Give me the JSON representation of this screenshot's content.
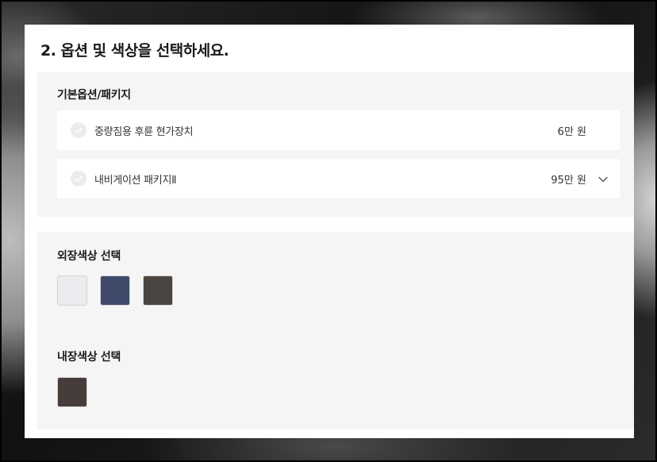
{
  "title": "2. 옵션 및 색상을 선택하세요.",
  "options_section": {
    "title": "기본옵션/패키지",
    "items": [
      {
        "label": "중량짐용 후륜 현가장치",
        "price": "6만 원",
        "expandable": false,
        "checked": false
      },
      {
        "label": "내비게이션 패키지Ⅱ",
        "price": "95만 원",
        "expandable": true,
        "checked": false
      }
    ]
  },
  "exterior_section": {
    "title": "외장색상 선택",
    "swatches": [
      {
        "color": "#ecebf0"
      },
      {
        "color": "#3f4a6b"
      },
      {
        "color": "#4b4542"
      }
    ]
  },
  "interior_section": {
    "title": "내장색상 선택",
    "swatches": [
      {
        "color": "#463d3a"
      }
    ]
  },
  "icons": {
    "check": "check-circle-icon",
    "expand": "chevron-down-icon"
  }
}
